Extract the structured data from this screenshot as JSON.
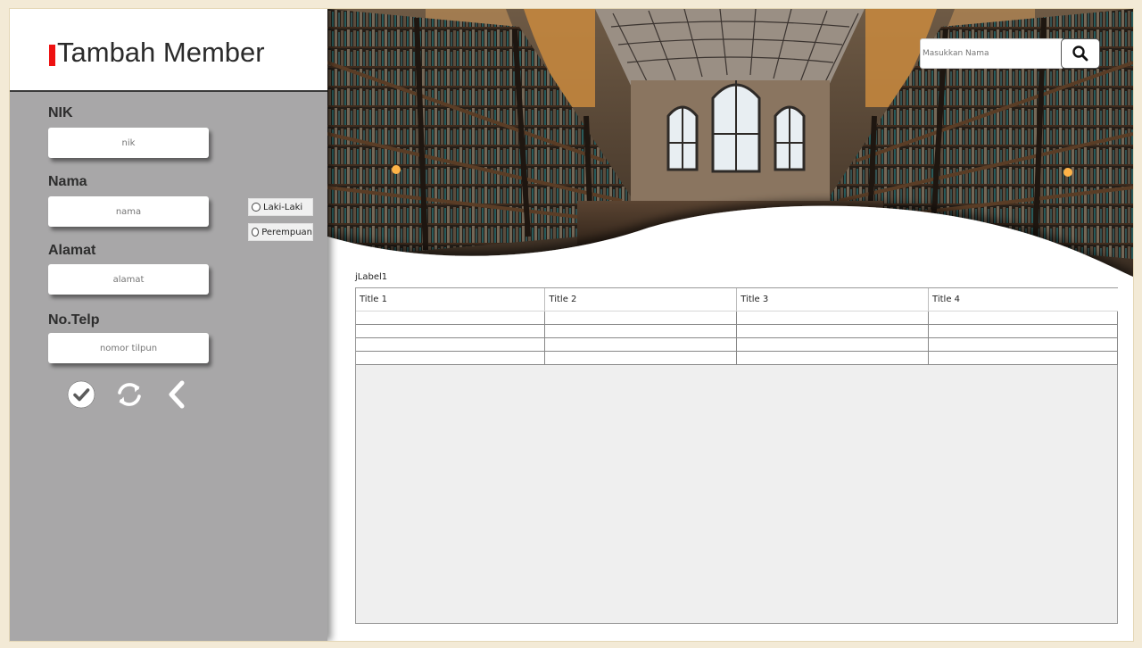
{
  "sidebar": {
    "title": "Tambah Member",
    "accent_color": "#ee1111",
    "fields": {
      "nik_label": "NIK",
      "nik_placeholder": "nik",
      "nama_label": "Nama",
      "nama_placeholder": "nama",
      "alamat_label": "Alamat",
      "alamat_placeholder": "alamat",
      "telp_label": "No.Telp",
      "telp_placeholder": "nomor tilpun"
    },
    "gender": {
      "male": "Laki-Laki",
      "female": "Perempuan"
    },
    "actions": [
      "check-circle-icon",
      "refresh-icon",
      "chevron-left-icon"
    ]
  },
  "search": {
    "placeholder": "Masukkan Nama",
    "icon": "search-icon"
  },
  "main": {
    "label": "jLabel1",
    "table": {
      "headers": [
        "Title 1",
        "Title 2",
        "Title 3",
        "Title 4"
      ],
      "rows": [
        [
          "",
          "",
          "",
          ""
        ],
        [
          "",
          "",
          "",
          ""
        ],
        [
          "",
          "",
          "",
          ""
        ],
        [
          "",
          "",
          "",
          ""
        ]
      ]
    }
  }
}
